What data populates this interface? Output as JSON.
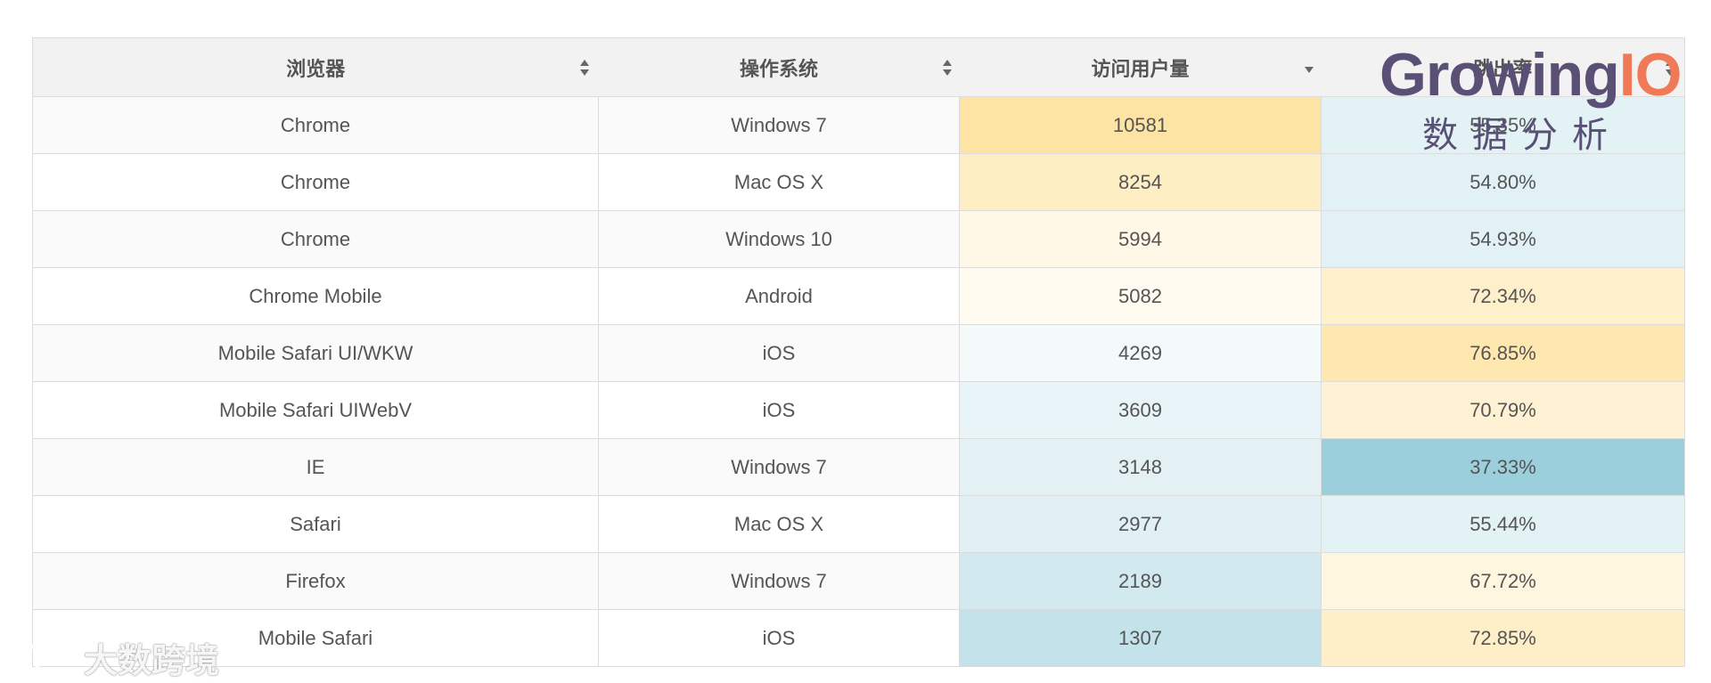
{
  "table": {
    "headers": [
      "浏览器",
      "操作系统",
      "访问用户量",
      "跳出率"
    ],
    "rows": [
      {
        "browser": "Chrome",
        "os": "Windows 7",
        "users": "10581",
        "bounce": "55.35%",
        "users_color": "#fee4a4",
        "bounce_color": "#e3f2f5"
      },
      {
        "browser": "Chrome",
        "os": "Mac OS X",
        "users": "8254",
        "bounce": "54.80%",
        "users_color": "#feeec4",
        "bounce_color": "#e2f1f5"
      },
      {
        "browser": "Chrome",
        "os": "Windows 10",
        "users": "5994",
        "bounce": "54.93%",
        "users_color": "#fff8e6",
        "bounce_color": "#e2f1f5"
      },
      {
        "browser": "Chrome Mobile",
        "os": "Android",
        "users": "5082",
        "bounce": "72.34%",
        "users_color": "#fffbf0",
        "bounce_color": "#fff0cc"
      },
      {
        "browser": "Mobile Safari UI/WKW",
        "os": "iOS",
        "users": "4269",
        "bounce": "76.85%",
        "users_color": "#f4f9fa",
        "bounce_color": "#fee8b0"
      },
      {
        "browser": "Mobile Safari UIWebV",
        "os": "iOS",
        "users": "3609",
        "bounce": "70.79%",
        "users_color": "#e8f4f7",
        "bounce_color": "#fff2d4"
      },
      {
        "browser": "IE",
        "os": "Windows 7",
        "users": "3148",
        "bounce": "37.33%",
        "users_color": "#e3f1f5",
        "bounce_color": "#9ccfdc"
      },
      {
        "browser": "Safari",
        "os": "Mac OS X",
        "users": "2977",
        "bounce": "55.44%",
        "users_color": "#e1f0f4",
        "bounce_color": "#e3f2f5"
      },
      {
        "browser": "Firefox",
        "os": "Windows 7",
        "users": "2189",
        "bounce": "67.72%",
        "users_color": "#d3e9f0",
        "bounce_color": "#fff6e0"
      },
      {
        "browser": "Mobile Safari",
        "os": "iOS",
        "users": "1307",
        "bounce": "72.85%",
        "users_color": "#c3e2ea",
        "bounce_color": "#ffefc8"
      }
    ]
  },
  "logo": {
    "word_main": "Growing",
    "word_accent": "IO",
    "subtitle": "数据分析",
    "main_color": "#5a5075",
    "accent_color": "#f07a57"
  },
  "watermark": {
    "text": "大数跨境"
  }
}
